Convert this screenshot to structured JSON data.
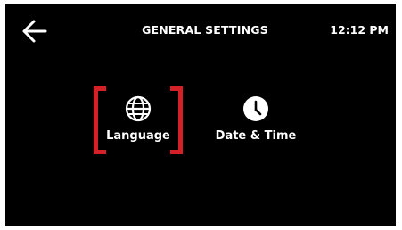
{
  "header": {
    "title": "GENERAL SETTINGS",
    "time": "12:12 PM",
    "back_icon": "arrow-left-icon"
  },
  "tiles": [
    {
      "label": "Language",
      "icon": "globe-icon",
      "selected": true
    },
    {
      "label": "Date & Time",
      "icon": "clock-icon",
      "selected": false
    }
  ],
  "colors": {
    "background": "#000000",
    "text": "#ffffff",
    "selection_bracket": "#d42027"
  }
}
